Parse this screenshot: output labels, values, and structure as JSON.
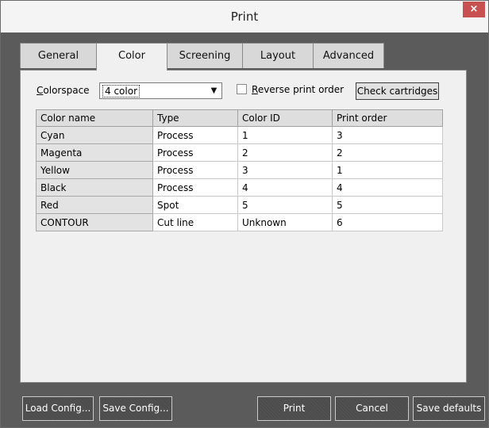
{
  "window": {
    "title": "Print",
    "close_glyph": "×"
  },
  "tabs": [
    "General",
    "Color",
    "Screening",
    "Layout",
    "Advanced"
  ],
  "active_tab": "Color",
  "colorspace": {
    "label": "Colorspace",
    "value": "4 color",
    "arrow_glyph": "▼"
  },
  "reverse_print_order": {
    "label": "Reverse print order",
    "checked": false
  },
  "check_cartridges_label": "Check cartridges",
  "table": {
    "columns": [
      "Color name",
      "Type",
      "Color ID",
      "Print order"
    ],
    "rows": [
      [
        "Cyan",
        "Process",
        "1",
        "3"
      ],
      [
        "Magenta",
        "Process",
        "2",
        "2"
      ],
      [
        "Yellow",
        "Process",
        "3",
        "1"
      ],
      [
        "Black",
        "Process",
        "4",
        "4"
      ],
      [
        "Red",
        "Spot",
        "5",
        "5"
      ],
      [
        "CONTOUR",
        "Cut line",
        "Unknown",
        "6"
      ]
    ]
  },
  "buttons": {
    "load_config": "Load Config...",
    "save_config": "Save Config...",
    "print": "Print",
    "cancel": "Cancel",
    "save_defaults": "Save defaults"
  },
  "colors": {
    "close_button": "#c75050",
    "frame": "#5b5b5b",
    "panel": "#f0f0f0"
  }
}
